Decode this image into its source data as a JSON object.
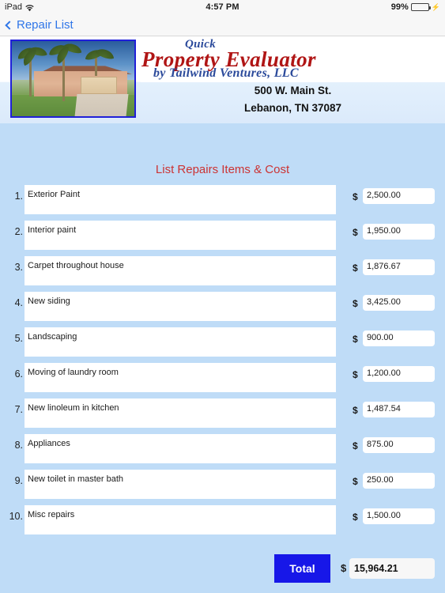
{
  "status_bar": {
    "device": "iPad",
    "wifi_icon": "wifi-icon",
    "time": "4:57 PM",
    "battery_percent": "99%",
    "battery_level": 99,
    "charging_icon": "lightning-bolt-icon"
  },
  "nav_bar": {
    "back_icon": "chevron-left-icon",
    "back_label": "Repair List"
  },
  "header": {
    "photo_alt": "house-photo",
    "logo_line1": "Quick",
    "logo_line2": "Property Evaluator",
    "logo_line3": "by Tailwind Ventures, LLC",
    "address_line1": "500 W. Main St.",
    "address_line2": "Lebanon, TN 37087",
    "logo_accent_red": "#b01515",
    "logo_accent_blue": "#2b4a9b"
  },
  "main": {
    "section_title": "List Repairs Items & Cost",
    "currency_symbol": "$",
    "rows": [
      {
        "number": "1.",
        "description": "Exterior Paint",
        "amount": "2,500.00"
      },
      {
        "number": "2.",
        "description": "Interior paint",
        "amount": "1,950.00"
      },
      {
        "number": "3.",
        "description": "Carpet throughout house",
        "amount": "1,876.67"
      },
      {
        "number": "4.",
        "description": "New siding",
        "amount": "3,425.00"
      },
      {
        "number": "5.",
        "description": "Landscaping",
        "amount": "900.00"
      },
      {
        "number": "6.",
        "description": "Moving of laundry room",
        "amount": "1,200.00"
      },
      {
        "number": "7.",
        "description": "New linoleum in kitchen",
        "amount": "1,487.54"
      },
      {
        "number": "8.",
        "description": "Appliances",
        "amount": "875.00"
      },
      {
        "number": "9.",
        "description": "New toilet in master bath",
        "amount": "250.00"
      },
      {
        "number": "10.",
        "description": "Misc repairs",
        "amount": "1,500.00"
      }
    ],
    "total_button_label": "Total",
    "total_currency_symbol": "$",
    "total_amount": "15,964.21"
  },
  "theme": {
    "page_background": "#bfdcf7",
    "total_button_color": "#1717e8",
    "title_color": "#cc3333",
    "link_color": "#2f76e8"
  }
}
